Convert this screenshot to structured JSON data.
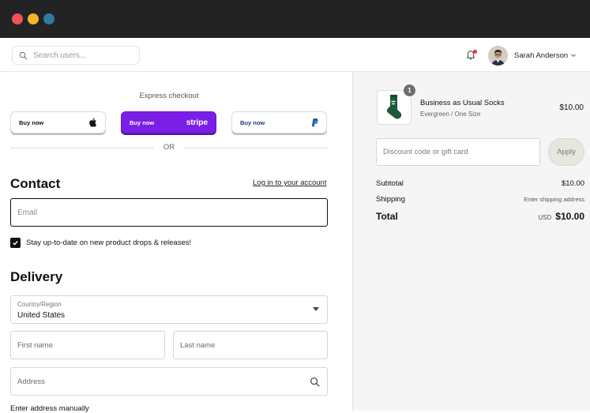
{
  "search": {
    "placeholder": "Search users..."
  },
  "user": {
    "name": "Sarah Anderson"
  },
  "checkout": {
    "express_label": "Express checkout",
    "buttons": [
      {
        "label": "Buy now",
        "brand": "apple-icon"
      },
      {
        "label": "Buy now",
        "brand_text": "stripe"
      },
      {
        "label": "Buy now",
        "brand": "paypal-icon"
      }
    ],
    "or_label": "OR"
  },
  "contact": {
    "title": "Contact",
    "login_link": "Log in to your account",
    "email_placeholder": "Email",
    "newsletter_label": "Stay up-to-date on new product drops & releases!"
  },
  "delivery": {
    "title": "Delivery",
    "country_label": "Country/Region",
    "country_value": "United States",
    "first_name_label": "First name",
    "last_name_label": "Last name",
    "address_label": "Address",
    "manual_link": "Enter address manually"
  },
  "order": {
    "item": {
      "quantity": "1",
      "name": "Business as Usual Socks",
      "variant": "Evergreen / One Size",
      "price": "$10.00"
    },
    "discount_placeholder": "Discount code or gift card",
    "apply_label": "Apply",
    "subtotal_label": "Subtotal",
    "subtotal_value": "$10.00",
    "shipping_label": "Shipping",
    "shipping_value": "Enter shipping address",
    "total_label": "Total",
    "total_currency": "USD",
    "total_value": "$10.00"
  },
  "colors": {
    "stripe_purple": "#7a1fe6",
    "titlebar": "#232323",
    "sidebar_bg": "#f5f5f5"
  }
}
